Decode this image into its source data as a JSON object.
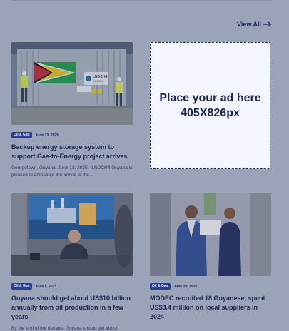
{
  "section": {
    "view_all_label": "View All"
  },
  "ad": {
    "text": "Place your ad here 405X826px"
  },
  "articles": [
    {
      "tag": "Oil & Gas",
      "date": "June 13, 2025",
      "title": "Backup energy storage system to support Gas-to-Energy project arrives",
      "excerpt": "Georgetown, Guyana. June 13, 2025 - LNDCH4 Guyana is pleased to announce the arrival of the...",
      "container_logo": "LNDCH4",
      "container_sub": "GUYANA"
    },
    {
      "tag": "Oil & Gas",
      "date": "June 5, 2025",
      "title": "Guyana should get about US$10 billion annually from oil production in a few years",
      "excerpt": "By the end of the decade, Guyana should get about"
    },
    {
      "tag": "Oil & Gas",
      "date": "June 20, 2025",
      "title": "MODEC recruited 18 Guyanese, spent US$3.4 million on local suppliers in 2024",
      "excerpt": ""
    }
  ],
  "colors": {
    "page_bg": "#9ba3b8",
    "tag_bg": "#2b3f8f",
    "text": "#1a2550",
    "ad_bg": "#f4f6ff"
  }
}
